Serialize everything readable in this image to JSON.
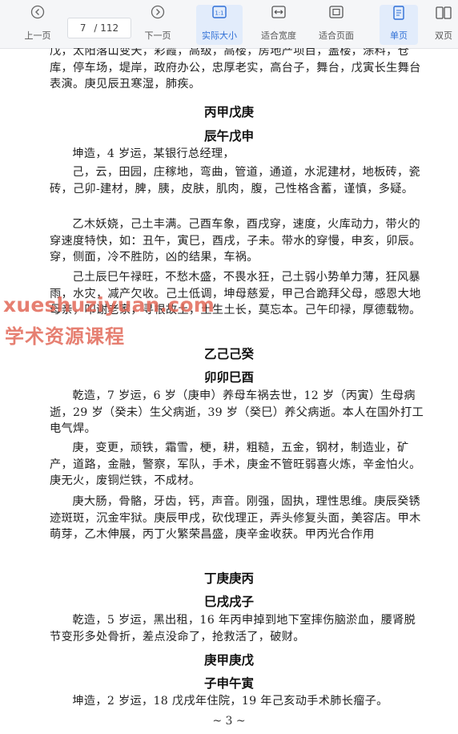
{
  "toolbar": {
    "prev_label": "上一页",
    "page_current": "7",
    "page_total": "/ 112",
    "next_label": "下一页",
    "actual_size_label": "实际大小",
    "fit_width_label": "适合宽度",
    "fit_page_label": "适合页面",
    "single_page_label": "单页",
    "double_page_label": "双页",
    "accent_color": "#2f6fd6"
  },
  "doc": {
    "line_top": "戊，太阳落山变天，彩霞，高级，高楼，房地产项目，盖楼，涂料，仓库，停车场，堤岸，政府办公，忠厚老实，高台子，舞台，戊寅长生舞台表演。庚见辰丑寒湿，肺疾。",
    "h1": "丙甲戊庚",
    "h2": "辰午戊申",
    "p1": "坤造，4 岁运，某银行总经理，",
    "p2": "己，云，田园，庄稼地，弯曲，管道，通道，水泥建材，地板砖，瓷砖，己卯-建材，脾，胰，皮肤，肌肉，腹，己性格含蓄，谨慎，多疑。",
    "p3": "乙木妖娆，己土丰满。己酉车象，酉戌穿，速度，火库动力，带火的穿速度特快，如：丑午，寅巳，酉戌，子未。带水的穿慢，申亥，卯辰。穿，侧面，冷不胜防，凶的结果，车祸。",
    "p4": "己土辰巳午禄旺，不愁木盛，不畏水狂，己土弱小势单力薄，狂风暴雨，水灾，减产欠收。己土低调，坤母慈爱，甲己合跪拜父母，感恩大地母亲，叩谢老家，寻根故土，土生土长，莫忘本。己午印禄，厚德载物。",
    "h3": "乙己己癸",
    "h4": "卯卯巳酉",
    "p5": "乾造，7 岁运，6 岁（庚申）养母车祸去世，12 岁（丙寅）生母病逝，29 岁（癸未）生父病逝，39 岁（癸巳）养父病逝。本人在国外打工电气焊。",
    "p6": "庚，变更，顽铁，霜雪，梗，耕，粗糙，五金，钢材，制造业，矿产，道路，金融，警察，军队，手术，庚金不管旺弱喜火炼，辛金怕火。庚无火，废铜烂铁，不成材。",
    "p7": "庚大肠，骨骼，牙齿，钙，声音。刚强，固执，理性思维。庚辰癸锈迹斑斑，沉金牢狱。庚辰甲戌，砍伐理正，弄头修复头面，美容店。甲木萌芽，乙木伸展，丙丁火繁荣昌盛，庚辛金收获。甲丙光合作用",
    "h5": "丁庚庚丙",
    "h6": "巳戌戌子",
    "p8": "乾造，5 岁运，黑出租，16 年丙申掉到地下室摔伤脑淤血，腰肾脱节变形多处骨折，差点没命了，抢救活了，破财。",
    "h7": "庚甲庚戊",
    "h8": "子申午寅",
    "p9": "坤造，2 岁运，18 戊戌年住院，19 年己亥动手术肺长瘤子。",
    "footer": "~ 3 ~"
  },
  "watermark": {
    "line1": "xueshuziyuan.com",
    "line2": "学术资源课程",
    "color": "#e26858"
  }
}
